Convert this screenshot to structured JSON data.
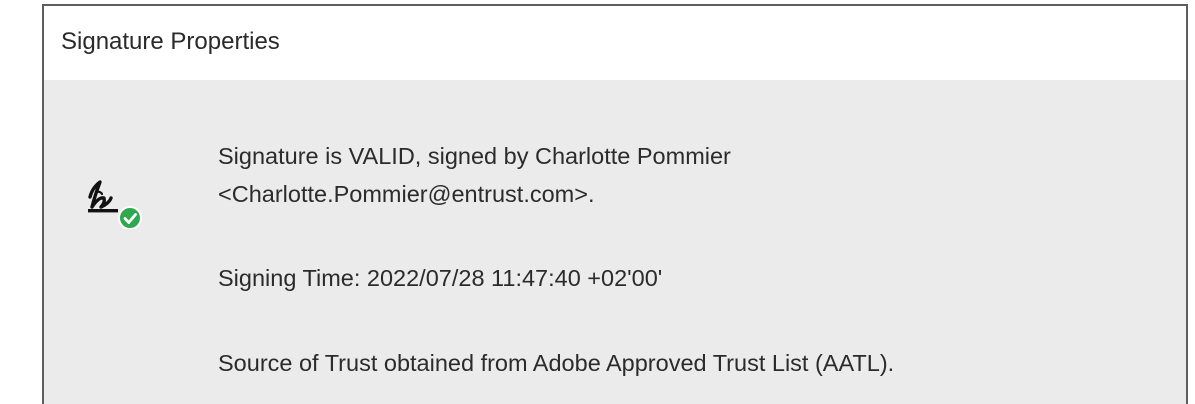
{
  "dialog": {
    "title": "Signature Properties"
  },
  "signature": {
    "status_icon": "signature-valid-icon",
    "status_line_1": "Signature is VALID, signed by Charlotte Pommier",
    "status_line_2": "<Charlotte.Pommier@entrust.com>.",
    "signing_time": "Signing Time:  2022/07/28 11:47:40 +02'00'",
    "trust_source": "Source of Trust obtained from Adobe Approved Trust List (AATL)."
  },
  "colors": {
    "check_badge": "#2fa84f",
    "dialog_background": "#ebebeb",
    "title_background": "#ffffff"
  }
}
